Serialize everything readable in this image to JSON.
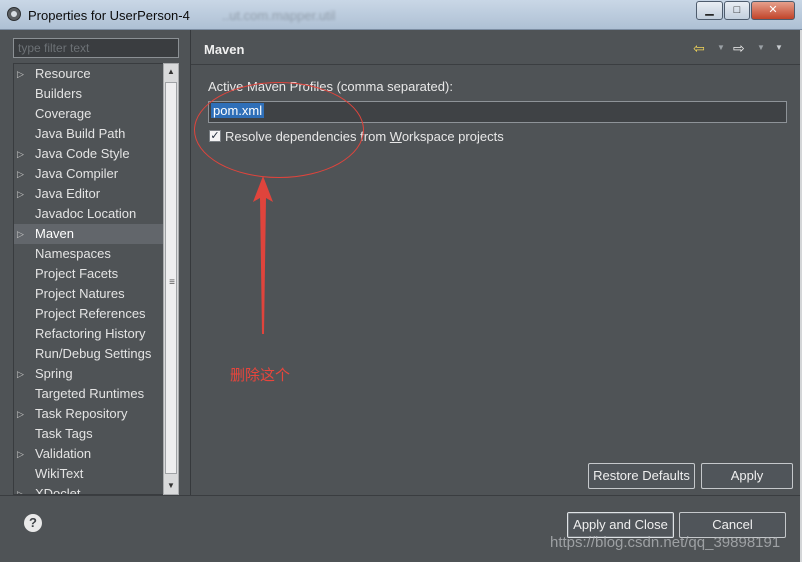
{
  "window": {
    "title": "Properties for UserPerson-4",
    "title_ghost": "..ut.com.mapper.util",
    "minimize_glyph": "▁",
    "maximize_glyph": "□",
    "close_glyph": "✕"
  },
  "sidebar": {
    "filter_placeholder": "type filter text",
    "items": [
      {
        "label": "Resource",
        "expandable": true
      },
      {
        "label": "Builders",
        "expandable": false
      },
      {
        "label": "Coverage",
        "expandable": false
      },
      {
        "label": "Java Build Path",
        "expandable": false
      },
      {
        "label": "Java Code Style",
        "expandable": true
      },
      {
        "label": "Java Compiler",
        "expandable": true
      },
      {
        "label": "Java Editor",
        "expandable": true
      },
      {
        "label": "Javadoc Location",
        "expandable": false
      },
      {
        "label": "Maven",
        "expandable": true,
        "selected": true
      },
      {
        "label": "Namespaces",
        "expandable": false
      },
      {
        "label": "Project Facets",
        "expandable": false
      },
      {
        "label": "Project Natures",
        "expandable": false
      },
      {
        "label": "Project References",
        "expandable": false
      },
      {
        "label": "Refactoring History",
        "expandable": false
      },
      {
        "label": "Run/Debug Settings",
        "expandable": false
      },
      {
        "label": "Spring",
        "expandable": true
      },
      {
        "label": "Targeted Runtimes",
        "expandable": false
      },
      {
        "label": "Task Repository",
        "expandable": true
      },
      {
        "label": "Task Tags",
        "expandable": false
      },
      {
        "label": "Validation",
        "expandable": true
      },
      {
        "label": "WikiText",
        "expandable": false
      },
      {
        "label": "XDoclet",
        "expandable": true
      }
    ],
    "chevron_glyph": "▷",
    "scroll_up_glyph": "▲",
    "scroll_down_glyph": "▼",
    "scroll_grip_glyph": "≡"
  },
  "page": {
    "title": "Maven",
    "back_glyph": "⇦",
    "forward_glyph": "⇨",
    "dropdown_glyph": "▼",
    "menu_glyph": "▼",
    "profiles_label": "Active Maven Profiles (comma separated):",
    "profiles_value": "pom.xml",
    "resolve_label_pre": "Resolve dependencies from ",
    "resolve_label_mnemonic": "W",
    "resolve_label_post": "orkspace projects",
    "resolve_checked": true,
    "check_glyph": "✓",
    "annotation_text": "删除这个",
    "annotation_color": "#e8453c",
    "restore_defaults_label": "Restore Defaults",
    "apply_label": "Apply"
  },
  "footer": {
    "help_glyph": "?",
    "apply_close_label": "Apply and Close",
    "cancel_label": "Cancel",
    "watermark": "https://blog.csdn.net/qq_39898191"
  },
  "colors": {
    "background": "#4f5356",
    "selection": "#2f6fb8",
    "annotation": "#e0443c"
  }
}
